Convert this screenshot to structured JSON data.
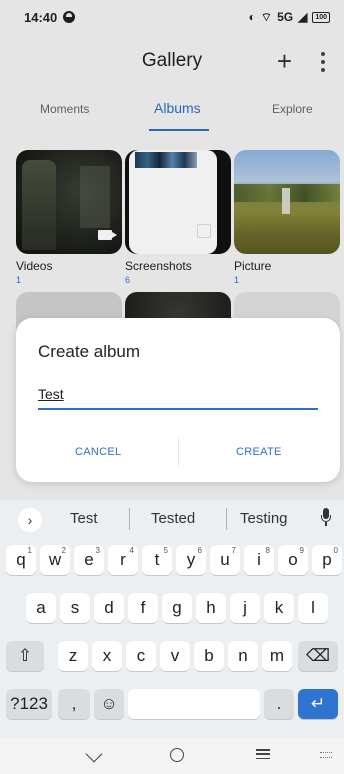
{
  "status_bar": {
    "time": "14:40",
    "network": "5G",
    "battery": "100"
  },
  "app_bar": {
    "title": "Gallery",
    "add_label": "+"
  },
  "tabs": [
    {
      "label": "Moments",
      "active": false
    },
    {
      "label": "Albums",
      "active": true
    },
    {
      "label": "Explore",
      "active": false
    }
  ],
  "albums": [
    {
      "name": "Videos",
      "count": "1"
    },
    {
      "name": "Screenshots",
      "count": "6"
    },
    {
      "name": "Picture",
      "count": "1"
    }
  ],
  "dialog": {
    "title": "Create album",
    "input_value": "Test",
    "cancel_label": "CANCEL",
    "create_label": "CREATE"
  },
  "keyboard": {
    "suggestions": [
      "Test",
      "Tested",
      "Testing"
    ],
    "rows": [
      [
        "q",
        "w",
        "e",
        "r",
        "t",
        "y",
        "u",
        "i",
        "o",
        "p"
      ],
      [
        "a",
        "s",
        "d",
        "f",
        "g",
        "h",
        "j",
        "k",
        "l"
      ],
      [
        "z",
        "x",
        "c",
        "v",
        "b",
        "n",
        "m"
      ]
    ],
    "hints": [
      "1",
      "2",
      "3",
      "4",
      "5",
      "6",
      "7",
      "8",
      "9",
      "0"
    ],
    "symbols_label": "?123",
    "comma_label": ",",
    "period_label": "."
  },
  "colors": {
    "accent": "#2f6fcf",
    "enter_key": "#2f74d0"
  }
}
